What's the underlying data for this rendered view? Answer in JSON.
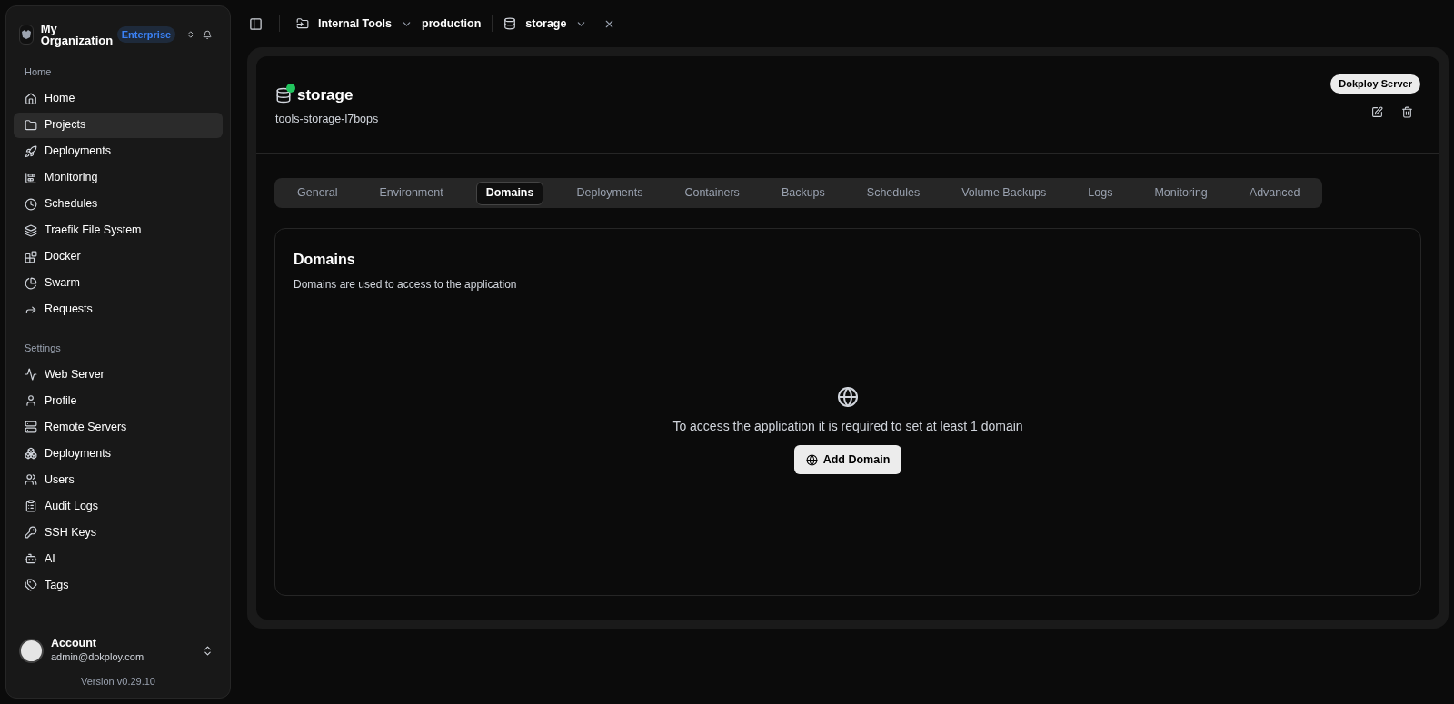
{
  "sidebar": {
    "organization": {
      "name": "My Organization",
      "plan": "Enterprise"
    },
    "sections": [
      {
        "title": "Home",
        "items": [
          {
            "label": "Home",
            "selected": false
          },
          {
            "label": "Projects",
            "selected": true
          },
          {
            "label": "Deployments",
            "selected": false
          },
          {
            "label": "Monitoring",
            "selected": false
          },
          {
            "label": "Schedules",
            "selected": false
          },
          {
            "label": "Traefik File System",
            "selected": false
          },
          {
            "label": "Docker",
            "selected": false
          },
          {
            "label": "Swarm",
            "selected": false
          },
          {
            "label": "Requests",
            "selected": false
          }
        ]
      },
      {
        "title": "Settings",
        "items": [
          {
            "label": "Web Server",
            "selected": false
          },
          {
            "label": "Profile",
            "selected": false
          },
          {
            "label": "Remote Servers",
            "selected": false
          },
          {
            "label": "Deployments",
            "selected": false
          },
          {
            "label": "Users",
            "selected": false
          },
          {
            "label": "Audit Logs",
            "selected": false
          },
          {
            "label": "SSH Keys",
            "selected": false
          },
          {
            "label": "AI",
            "selected": false
          },
          {
            "label": "Tags",
            "selected": false
          }
        ]
      }
    ],
    "account": {
      "name": "Account",
      "email": "admin@dokploy.com"
    },
    "version": "Version v0.29.10"
  },
  "breadcrumb": {
    "project": "Internal Tools",
    "environment": "production",
    "service": "storage"
  },
  "service": {
    "name": "storage",
    "app_name": "tools-storage-l7bops",
    "running": true,
    "server": "Dokploy Server"
  },
  "tabs": [
    {
      "label": "General",
      "selected": false
    },
    {
      "label": "Environment",
      "selected": false
    },
    {
      "label": "Domains",
      "selected": true
    },
    {
      "label": "Deployments",
      "selected": false
    },
    {
      "label": "Containers",
      "selected": false
    },
    {
      "label": "Backups",
      "selected": false
    },
    {
      "label": "Schedules",
      "selected": false
    },
    {
      "label": "Volume Backups",
      "selected": false
    },
    {
      "label": "Logs",
      "selected": false
    },
    {
      "label": "Monitoring",
      "selected": false
    },
    {
      "label": "Advanced",
      "selected": false
    }
  ],
  "domains": {
    "title": "Domains",
    "description": "Domains are used to access to the application",
    "empty_message": "To access the application it is required to set at least 1 domain",
    "button": "Add Domain"
  }
}
